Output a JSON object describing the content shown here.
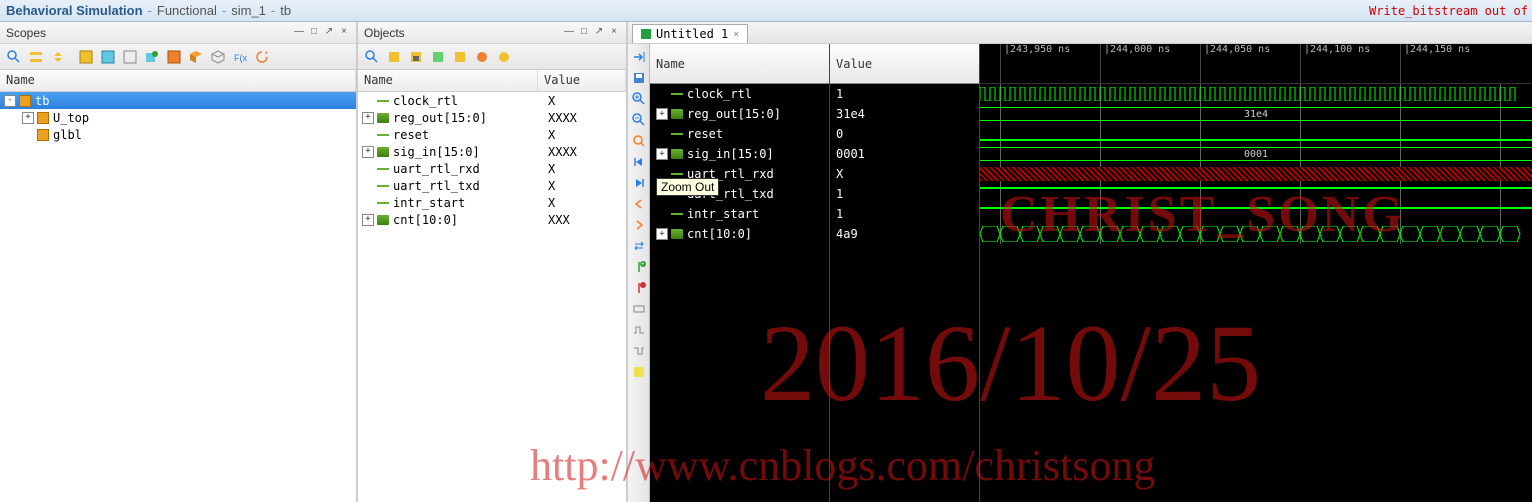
{
  "title": {
    "main": "Behavioral Simulation",
    "seg2": "Functional",
    "seg3": "sim_1",
    "seg4": "tb",
    "right_msg": "Write_bitstream out of"
  },
  "scopes": {
    "panel_title": "Scopes",
    "col_name": "Name",
    "tree": [
      {
        "label": "tb",
        "level": 0,
        "exp": "-",
        "sel": true
      },
      {
        "label": "U_top",
        "level": 1,
        "exp": "+",
        "sel": false
      },
      {
        "label": "glbl",
        "level": 1,
        "exp": "",
        "sel": false
      }
    ]
  },
  "objects": {
    "panel_title": "Objects",
    "col_name": "Name",
    "col_value": "Value",
    "rows": [
      {
        "name": "clock_rtl",
        "value": "X",
        "exp": "",
        "type": "sig"
      },
      {
        "name": "reg_out[15:0]",
        "value": "XXXX",
        "exp": "+",
        "type": "bus"
      },
      {
        "name": "reset",
        "value": "X",
        "exp": "",
        "type": "sig"
      },
      {
        "name": "sig_in[15:0]",
        "value": "XXXX",
        "exp": "+",
        "type": "bus"
      },
      {
        "name": "uart_rtl_rxd",
        "value": "X",
        "exp": "",
        "type": "sig"
      },
      {
        "name": "uart_rtl_txd",
        "value": "X",
        "exp": "",
        "type": "sig"
      },
      {
        "name": "intr_start",
        "value": "X",
        "exp": "",
        "type": "sig"
      },
      {
        "name": "cnt[10:0]",
        "value": "XXX",
        "exp": "+",
        "type": "bus"
      }
    ]
  },
  "wave": {
    "tab_label": "Untitled 1",
    "col_name": "Name",
    "col_value": "Value",
    "tooltip": "Zoom Out",
    "ticks": [
      "|243,950 ns",
      "|244,000 ns",
      "|244,050 ns",
      "|244,100 ns",
      "|244,150 ns"
    ],
    "rows": [
      {
        "name": "clock_rtl",
        "value": "1",
        "exp": "",
        "type": "clock"
      },
      {
        "name": "reg_out[15:0]",
        "value": "31e4",
        "exp": "+",
        "type": "bus",
        "buslabel": "31e4"
      },
      {
        "name": "reset",
        "value": "0",
        "exp": "",
        "type": "low"
      },
      {
        "name": "sig_in[15:0]",
        "value": "0001",
        "exp": "+",
        "type": "bus",
        "buslabel": "0001"
      },
      {
        "name": "uart_rtl_rxd",
        "value": "X",
        "exp": "",
        "type": "x"
      },
      {
        "name": "uart_rtl_txd",
        "value": "1",
        "exp": "",
        "type": "high"
      },
      {
        "name": "intr_start",
        "value": "1",
        "exp": "",
        "type": "high"
      },
      {
        "name": "cnt[10:0]",
        "value": "4a9",
        "exp": "+",
        "type": "busx"
      }
    ]
  },
  "watermark": {
    "name": "CHRIST_SONG",
    "date": "2016/10/25",
    "url": "http://www.cnblogs.com/christsong"
  }
}
